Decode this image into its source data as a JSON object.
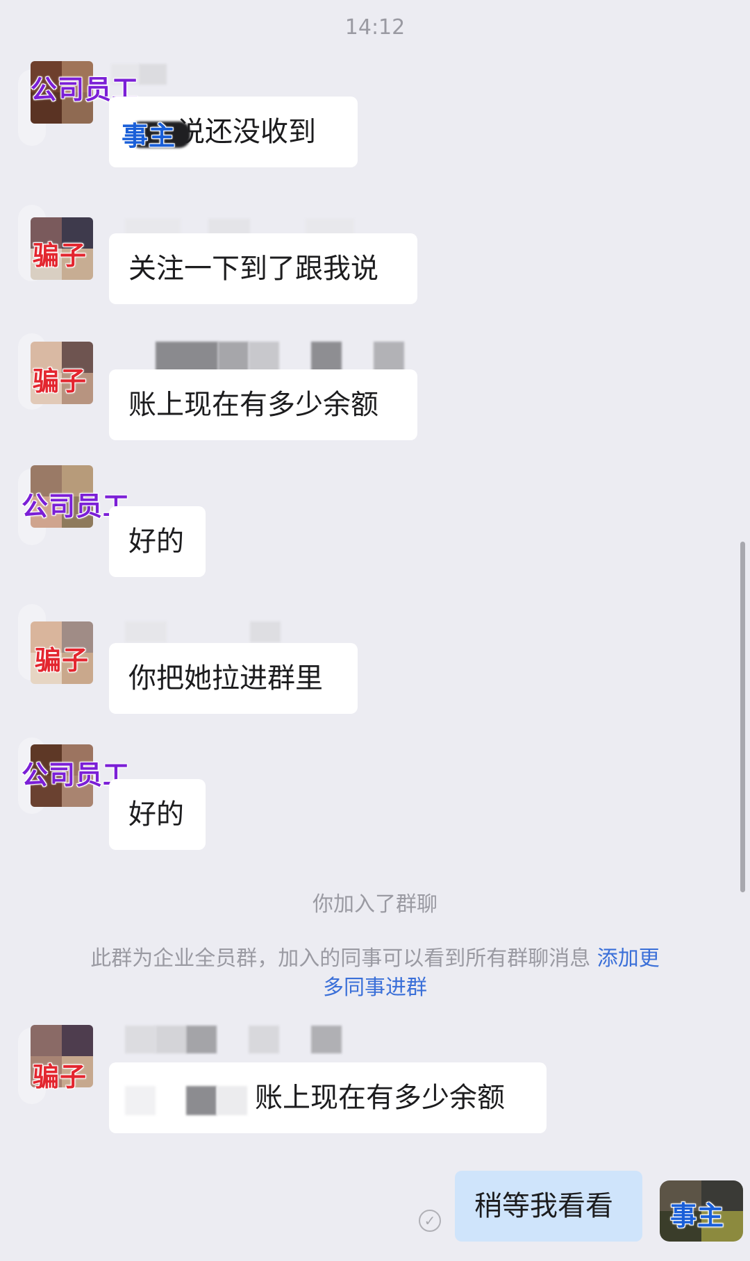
{
  "timestamp": "14:12",
  "labels": {
    "staff": "公司员工",
    "scammer": "骗子",
    "owner": "事主"
  },
  "messages": [
    {
      "sender": "staff",
      "text": "说还没收到",
      "mention": "事主"
    },
    {
      "sender": "scammer",
      "text": "关注一下到了跟我说"
    },
    {
      "sender": "scammer",
      "text": "账上现在有多少余额"
    },
    {
      "sender": "staff",
      "text": "好的"
    },
    {
      "sender": "scammer",
      "text": "你把她拉进群里"
    },
    {
      "sender": "staff",
      "text": "好的"
    }
  ],
  "system": {
    "joined": "你加入了群聊",
    "notice": "此群为企业全员群，加入的同事可以看到所有群聊消息",
    "notice_link_line1": "添加更",
    "notice_link_line2": "多同事进群"
  },
  "after_join": [
    {
      "sender": "scammer",
      "text": "账上现在有多少余额"
    },
    {
      "sender": "owner",
      "text": "稍等我看看"
    }
  ],
  "colors": {
    "background": "#ececf2",
    "bubble_in": "#ffffff",
    "bubble_out": "#cfe4fb",
    "staff_tag": "#7b1fd6",
    "scammer_tag": "#e3262f",
    "owner_tag": "#1a5fd8",
    "link": "#3a6fd8"
  },
  "icons": {
    "read_status": "check-circle-icon"
  }
}
